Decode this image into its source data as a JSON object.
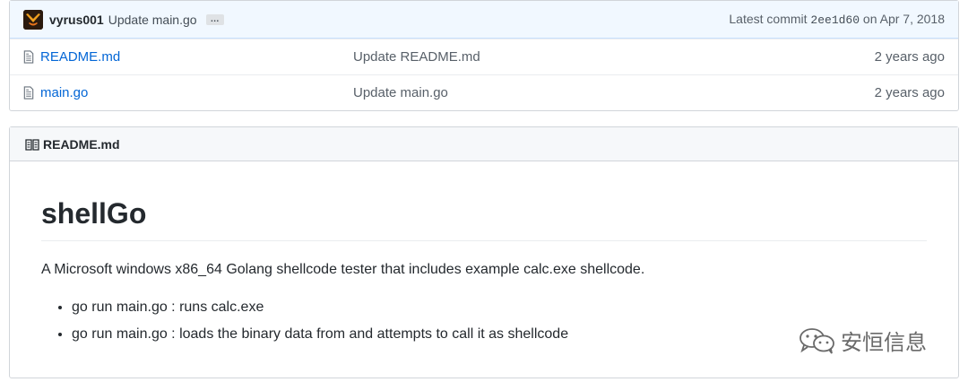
{
  "latest_commit": {
    "author": "vyrus001",
    "message": "Update main.go",
    "ellipsis": "…",
    "prefix": "Latest commit",
    "sha": "2ee1d60",
    "date_text": "on Apr 7, 2018"
  },
  "files": [
    {
      "name": "README.md",
      "message": "Update README.md",
      "age": "2 years ago"
    },
    {
      "name": "main.go",
      "message": "Update main.go",
      "age": "2 years ago"
    }
  ],
  "readme": {
    "header": "README.md",
    "title": "shellGo",
    "description": "A Microsoft windows x86_64 Golang shellcode tester that includes example calc.exe shellcode.",
    "items": [
      "go run main.go : runs calc.exe",
      "go run main.go : loads the binary data from and attempts to call it as shellcode"
    ]
  },
  "watermark": {
    "text": "安恒信息"
  },
  "colors": {
    "link": "#0366d6",
    "commit_bar": "#f1f8ff",
    "border": "#d1d5da"
  },
  "icons": [
    "avatar",
    "file-icon",
    "book-icon",
    "wechat-icon"
  ]
}
